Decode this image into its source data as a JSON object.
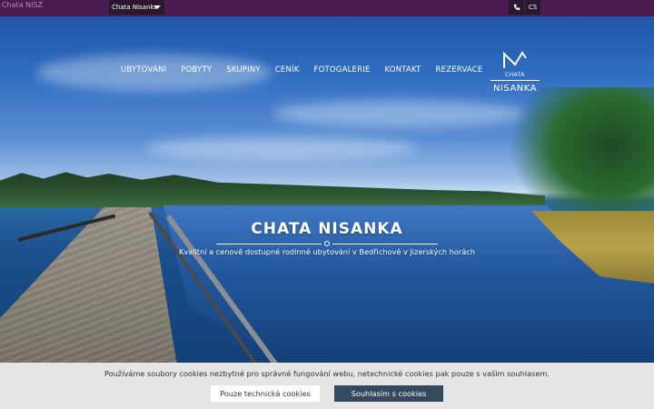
{
  "topbar": {
    "broken_image_alt": "Chata NISZ",
    "language_select": "Chata Nisanka",
    "phone_icon": "phone-icon",
    "language_code": "CS"
  },
  "nav": {
    "items": [
      "UBYTOVÁNÍ",
      "POBYTY",
      "SKUPINY",
      "CENÍK",
      "FOTOGALERIE",
      "KONTAKT",
      "REZERVACE"
    ]
  },
  "logo": {
    "small": "CHATA",
    "big": "NISANKA"
  },
  "hero": {
    "title": "CHATA NISANKA",
    "subtitle": "Kvalitní a cenově dostupné rodinné ubytování v Bedřichově v Jizerských horách"
  },
  "cookie": {
    "text": "Používáme soubory cookies nezbytné pro správné fungování webu, netechnické cookies pak pouze s vaším souhlasem.",
    "tech_button": "Pouze technická cookies",
    "agree_button": "Souhlasím s cookies"
  },
  "colors": {
    "topbar": "#4a1d52",
    "cookie_bg": "#e6e6e6",
    "agree_bg": "#34495e"
  }
}
